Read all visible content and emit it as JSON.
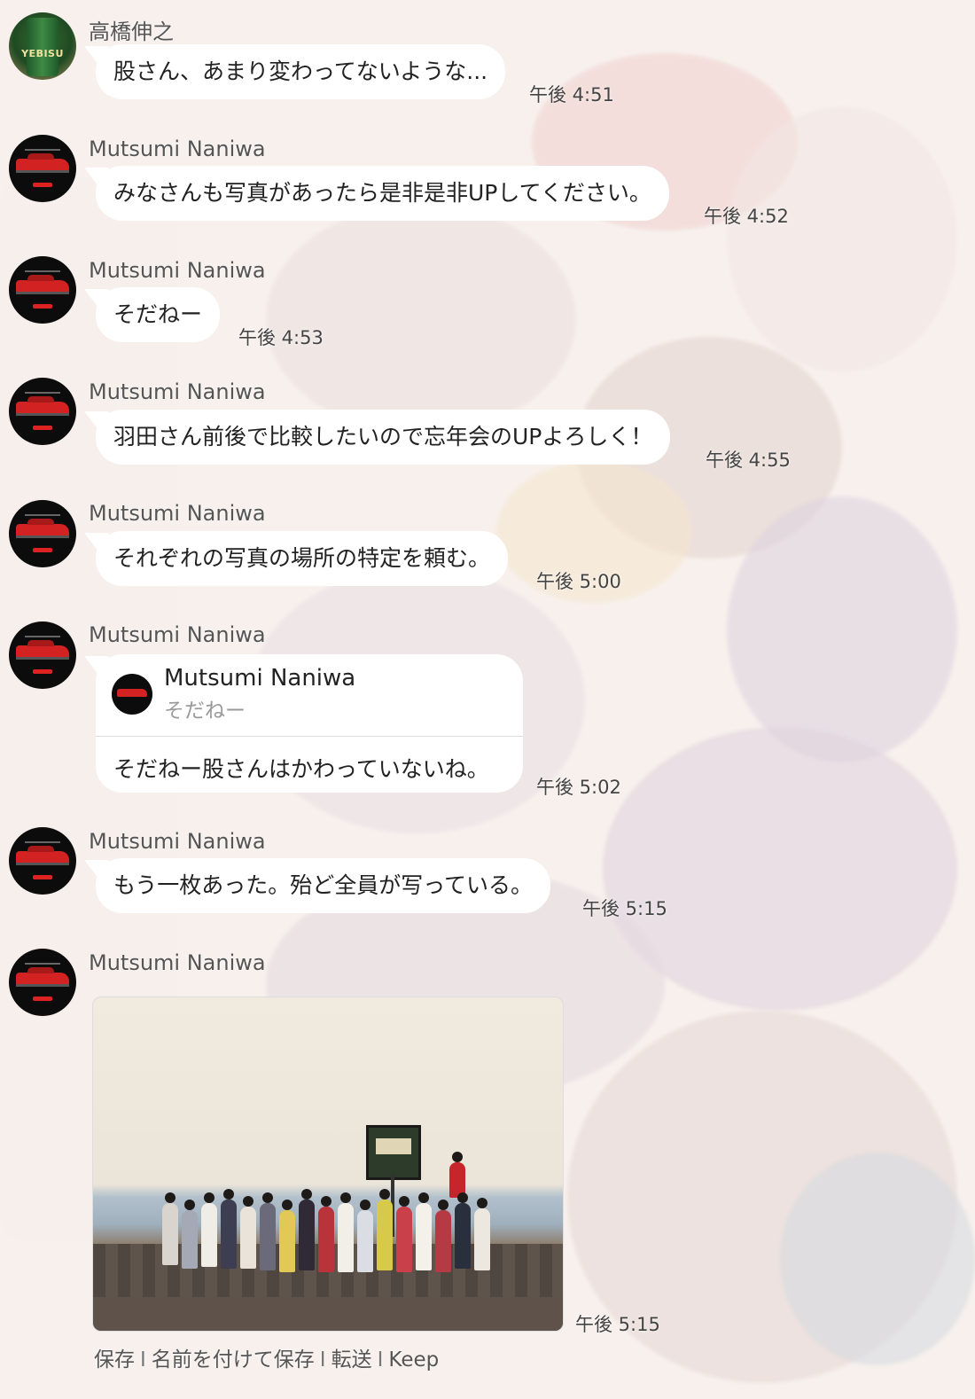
{
  "colors": {
    "bubble": "#ffffff",
    "background": "#f4ece6",
    "avatar_dark": "#0c0c0c",
    "avatar_accent": "#d22222"
  },
  "messages": [
    {
      "sender": "高橋伸之",
      "avatar": "yebisu-beer-avatar",
      "avatar_text": "YEBISU",
      "text": "股さん、あまり変わってないような...",
      "time": "午後 4:51"
    },
    {
      "sender": "Mutsumi Naniwa",
      "avatar": "red-car-avatar",
      "text": "みなさんも写真があったら是非是非UPしてください。",
      "time": "午後 4:52"
    },
    {
      "sender": "Mutsumi Naniwa",
      "avatar": "red-car-avatar",
      "text": "そだねー",
      "time": "午後 4:53"
    },
    {
      "sender": "Mutsumi Naniwa",
      "avatar": "red-car-avatar",
      "text": "羽田さん前後で比較したいので忘年会のUPよろしく！",
      "time": "午後 4:55"
    },
    {
      "sender": "Mutsumi Naniwa",
      "avatar": "red-car-avatar",
      "text": "それぞれの写真の場所の特定を頼む。",
      "time": "午後 5:00"
    },
    {
      "sender": "Mutsumi Naniwa",
      "avatar": "red-car-avatar",
      "quote": {
        "name": "Mutsumi Naniwa",
        "text": "そだねー"
      },
      "text": "そだねー股さんはかわっていないね。",
      "time": "午後 5:02"
    },
    {
      "sender": "Mutsumi Naniwa",
      "avatar": "red-car-avatar",
      "text": "もう一枚あった。殆ど全員が写っている。",
      "time": "午後 5:15"
    },
    {
      "sender": "Mutsumi Naniwa",
      "avatar": "red-car-avatar",
      "image": "group-photo",
      "time": "午後 5:15"
    }
  ],
  "image_actions": [
    "保存",
    "名前を付けて保存",
    "転送",
    "Keep"
  ],
  "image_actions_separator": "I"
}
